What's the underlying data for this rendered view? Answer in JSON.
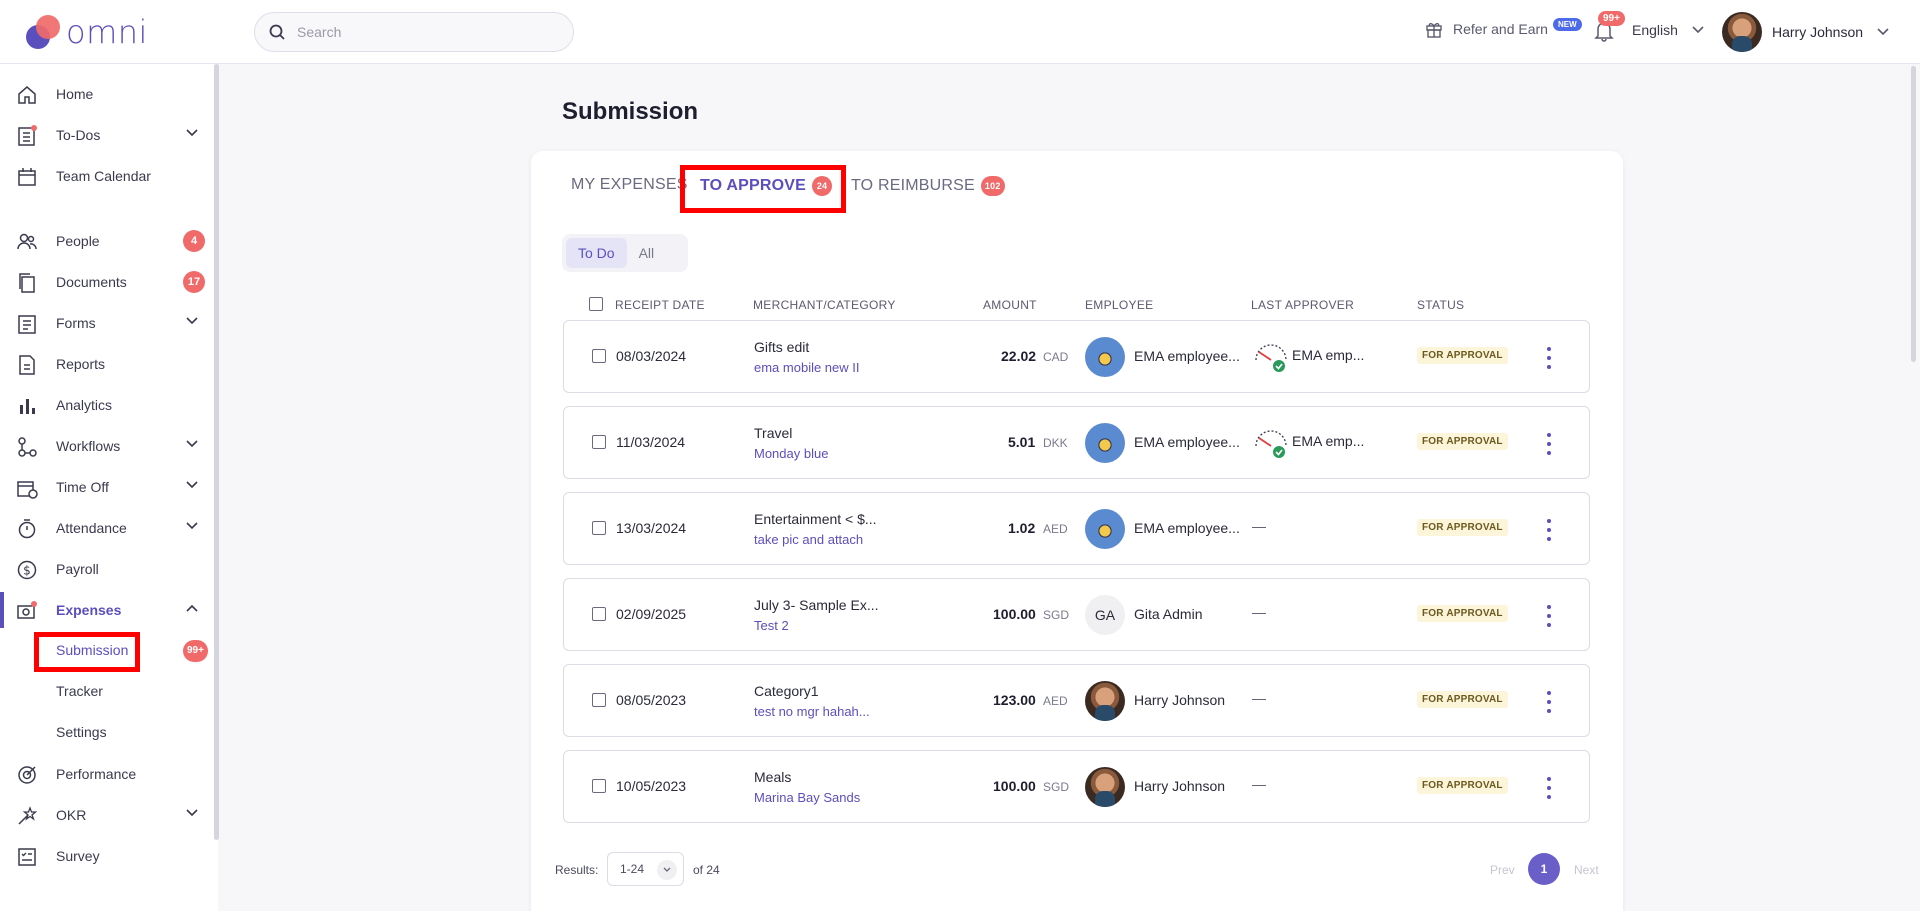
{
  "app": {
    "name": "omni"
  },
  "search": {
    "placeholder": "Search"
  },
  "header": {
    "refer_label": "Refer and Earn",
    "refer_badge": "NEW",
    "notif_count": "99+",
    "language": "English",
    "user_name": "Harry Johnson"
  },
  "sidebar": {
    "items": [
      {
        "label": "Home",
        "icon": "home-icon"
      },
      {
        "label": "To-Dos",
        "icon": "todos-icon"
      },
      {
        "label": "Team Calendar",
        "icon": "calendar-icon"
      },
      {
        "label": "People",
        "icon": "people-icon",
        "count": "4"
      },
      {
        "label": "Documents",
        "icon": "documents-icon",
        "count": "17"
      },
      {
        "label": "Forms",
        "icon": "forms-icon"
      },
      {
        "label": "Reports",
        "icon": "reports-icon"
      },
      {
        "label": "Analytics",
        "icon": "analytics-icon"
      },
      {
        "label": "Workflows",
        "icon": "workflows-icon"
      },
      {
        "label": "Time Off",
        "icon": "time-off-icon"
      },
      {
        "label": "Attendance",
        "icon": "attendance-icon"
      },
      {
        "label": "Payroll",
        "icon": "payroll-icon"
      },
      {
        "label": "Expenses",
        "icon": "expenses-icon"
      },
      {
        "label": "Performance",
        "icon": "performance-icon"
      },
      {
        "label": "OKR",
        "icon": "okr-icon"
      },
      {
        "label": "Survey",
        "icon": "survey-icon"
      }
    ],
    "expenses_sub": [
      {
        "label": "Submission",
        "count": "99+"
      },
      {
        "label": "Tracker"
      },
      {
        "label": "Settings"
      }
    ]
  },
  "main": {
    "title": "Submission",
    "tabs": [
      {
        "label": "MY EXPENSES"
      },
      {
        "label": "TO APPROVE",
        "count": "24"
      },
      {
        "label": "TO REIMBURSE",
        "count": "102"
      }
    ],
    "filters": [
      "To Do",
      "All"
    ],
    "columns": [
      "RECEIPT DATE",
      "MERCHANT/CATEGORY",
      "AMOUNT",
      "EMPLOYEE",
      "LAST APPROVER",
      "STATUS"
    ],
    "rows": [
      {
        "date": "08/03/2024",
        "merchant": "Gifts edit",
        "category": "ema mobile new II",
        "amount": "22.02",
        "currency": "CAD",
        "employee": "EMA employee...",
        "approver": "EMA emp...",
        "status": "FOR APPROVAL"
      },
      {
        "date": "11/03/2024",
        "merchant": "Travel",
        "category": "Monday blue",
        "amount": "5.01",
        "currency": "DKK",
        "employee": "EMA employee...",
        "approver": "EMA emp...",
        "status": "FOR APPROVAL"
      },
      {
        "date": "13/03/2024",
        "merchant": "Entertainment < $...",
        "category": "take pic and attach",
        "amount": "1.02",
        "currency": "AED",
        "employee": "EMA employee...",
        "approver": "—",
        "status": "FOR APPROVAL"
      },
      {
        "date": "02/09/2025",
        "merchant": "July 3- Sample Ex...",
        "category": "Test 2",
        "amount": "100.00",
        "currency": "SGD",
        "employee": "Gita Admin",
        "employee_initials": "GA",
        "approver": "—",
        "status": "FOR APPROVAL"
      },
      {
        "date": "08/05/2023",
        "merchant": "Category1",
        "category": "test no mgr hahah...",
        "amount": "123.00",
        "currency": "AED",
        "employee": "Harry Johnson",
        "approver": "—",
        "status": "FOR APPROVAL"
      },
      {
        "date": "10/05/2023",
        "merchant": "Meals",
        "category": "Marina Bay Sands",
        "amount": "100.00",
        "currency": "SGD",
        "employee": "Harry Johnson",
        "approver": "—",
        "status": "FOR APPROVAL"
      }
    ],
    "footer": {
      "results_label": "Results:",
      "range": "1-24",
      "total": "of 24",
      "prev": "Prev",
      "page": "1",
      "next": "Next"
    }
  },
  "colors": {
    "accent": "#5b4fbd",
    "badge": "#f06a6a",
    "highlight": "#ff0000"
  }
}
